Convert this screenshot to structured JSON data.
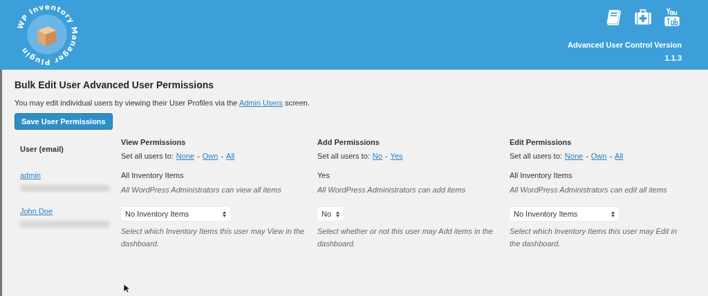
{
  "header": {
    "logo_text": "WP Inventory Manager Plugin",
    "version_label": "Advanced User Control Version",
    "version": "1.1.3"
  },
  "title": "Bulk Edit User Advanced User Permissions",
  "intro": {
    "before": "You may edit individual users by viewing their User Profiles via the ",
    "link": "Admin Users",
    "after": " screen."
  },
  "save_button": "Save User Permissions",
  "table": {
    "user_column": "User (email)",
    "columns": [
      {
        "title": "View Permissions",
        "set_all_label": "Set all users to:",
        "separator": "-",
        "options": [
          "None",
          "Own",
          "All"
        ]
      },
      {
        "title": "Add Permissions",
        "set_all_label": "Set all users to:",
        "separator": "-",
        "options": [
          "No",
          "Yes"
        ]
      },
      {
        "title": "Edit Permissions",
        "set_all_label": "Set all users to:",
        "separator": "-",
        "options": [
          "None",
          "Own",
          "All"
        ]
      }
    ],
    "rows": [
      {
        "name": "admin",
        "cells": [
          {
            "kind": "fixed",
            "value": "All Inventory Items",
            "note": "All WordPress Administrators can view all items"
          },
          {
            "kind": "fixed",
            "value": "Yes",
            "note": "All WordPress Administrators can add items"
          },
          {
            "kind": "fixed",
            "value": "All Inventory Items",
            "note": "All WordPress Administrators can edit all items"
          }
        ]
      },
      {
        "name": "John Doe",
        "cells": [
          {
            "kind": "select",
            "value": "No Inventory Items",
            "note": "Select which Inventory Items this user may View in the dashboard."
          },
          {
            "kind": "select",
            "value": "No",
            "note": "Select whether or not this user may Add items in the dashboard."
          },
          {
            "kind": "select",
            "value": "No Inventory Items",
            "note": "Select which Inventory Items this user may Edit in the dashboard."
          }
        ]
      }
    ]
  }
}
